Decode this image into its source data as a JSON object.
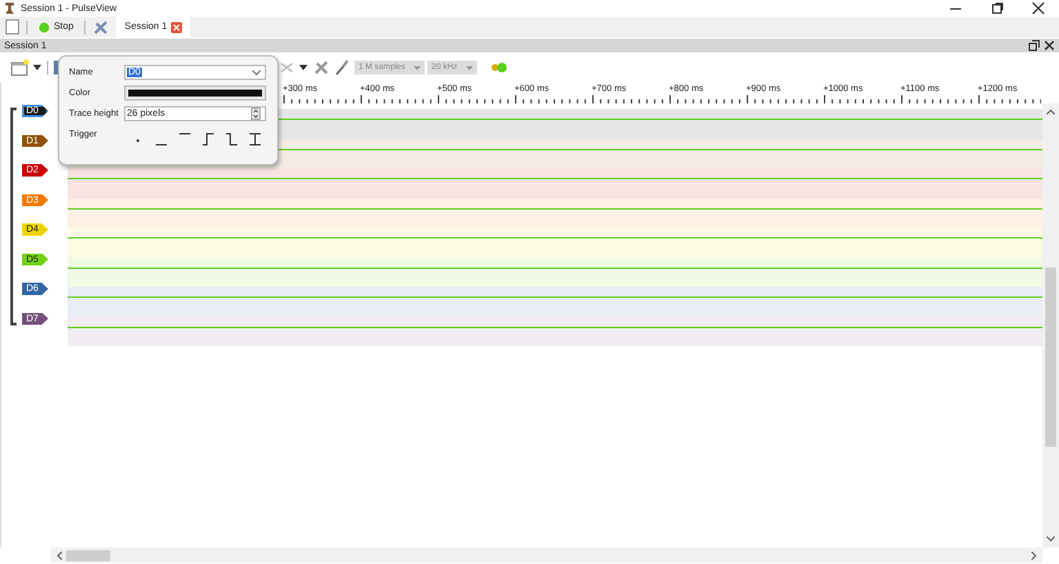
{
  "window": {
    "title": "Session 1 - PulseView"
  },
  "main_toolbar": {
    "run_button": "Stop",
    "tabs": [
      {
        "label": "Session 1",
        "selected": true
      }
    ]
  },
  "dock": {
    "title": "Session 1"
  },
  "session_toolbar": {
    "samples": "1 M samples",
    "rate": "20 kHz"
  },
  "ruler": {
    "labels": [
      "+300 ms",
      "+400 ms",
      "+500 ms",
      "+600 ms",
      "+700 ms",
      "+800 ms",
      "+900 ms",
      "+1000 ms",
      "+1100 ms",
      "+1200 ms"
    ]
  },
  "channels": [
    {
      "name": "D0",
      "color": "#1a1a1a",
      "selected": true
    },
    {
      "name": "D1",
      "color": "#8f5202",
      "selected": false
    },
    {
      "name": "D2",
      "color": "#cc0000",
      "selected": false
    },
    {
      "name": "D3",
      "color": "#f57900",
      "selected": false
    },
    {
      "name": "D4",
      "color": "#edd400",
      "selected": false
    },
    {
      "name": "D5",
      "color": "#73d216",
      "selected": false
    },
    {
      "name": "D6",
      "color": "#3465a4",
      "selected": false
    },
    {
      "name": "D7",
      "color": "#75507b",
      "selected": false
    }
  ],
  "popup": {
    "name_label": "Name",
    "name_value": "D0",
    "color_label": "Color",
    "color": "#111111",
    "height_label": "Trace height",
    "height_value": "26 pixels",
    "trigger_label": "Trigger"
  }
}
